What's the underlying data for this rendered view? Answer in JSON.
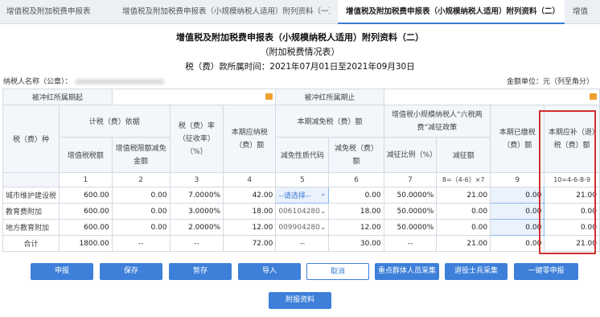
{
  "tabs": [
    "增值税及附加税费申报表",
    "增值税及附加税费申报表（小规模纳税人适用）附列资料（一）",
    "增值税及附加税费申报表（小规模纳税人适用）附列资料（二）",
    "增值"
  ],
  "form": {
    "title": "增值税及附加税费申报表（小规模纳税人适用）附列资料（二）",
    "subtitle": "（附加税费情况表）",
    "period": "税（费）款所属时间：2021年07月01日至2021年09月30日",
    "taxpayer_label": "纳税人名称（公章）：",
    "unit_label": "金额单位：元（列至角分）"
  },
  "table": {
    "offset_start_label": "被冲红所属期起",
    "offset_end_label": "被冲红所属期止",
    "col_tax_type": "税（费）种",
    "group_basis": "计税（费）依据",
    "col_vat_amount": "增值税税额",
    "col_vat_exempt": "增值税限额减免金额",
    "col_rate": "税（费）率（征收率）（%）",
    "col_payable": "本期应纳税（费）额",
    "group_relief": "本期减免税（费）额",
    "col_relief_code": "减免性质代码",
    "col_relief_amount": "减免税（费）额",
    "group_six_tax": "增值税小规模纳税人“六税两费”减征政策",
    "col_reduce_ratio": "减征比例（%）",
    "col_reduce_amount": "减征额",
    "col_paid": "本期已缴税（费）额",
    "col_refund": "本期应补（退）税（费）额",
    "col_numbers": [
      "1",
      "2",
      "3",
      "4",
      "5",
      "6",
      "7",
      "8=（4-6）×7",
      "9",
      "10=4-6-8-9"
    ],
    "rows": [
      {
        "name": "城市维护建设税",
        "vat": "600.00",
        "exempt": "0.00",
        "rate": "7.0000%",
        "payable": "42.00",
        "code": "--请选择--",
        "relief": "0.00",
        "ratio": "50.0000%",
        "reduce": "21.00",
        "paid": "0.00",
        "refund": "21.00"
      },
      {
        "name": "教育费附加",
        "vat": "600.00",
        "exempt": "0.00",
        "rate": "3.0000%",
        "payable": "18.00",
        "code": "006104280",
        "relief": "18.00",
        "ratio": "50.0000%",
        "reduce": "0.00",
        "paid": "0.00",
        "refund": "0.00"
      },
      {
        "name": "地方教育附加",
        "vat": "600.00",
        "exempt": "0.00",
        "rate": "2.0000%",
        "payable": "12.00",
        "code": "009904280",
        "relief": "12.00",
        "ratio": "50.0000%",
        "reduce": "0.00",
        "paid": "0.00",
        "refund": "0.00"
      }
    ],
    "total": {
      "name": "合计",
      "vat": "1800.00",
      "exempt": "--",
      "rate": "--",
      "payable": "72.00",
      "code": "--",
      "relief": "30.00",
      "ratio": "--",
      "reduce": "21.00",
      "paid": "0.00",
      "refund": "21.00"
    }
  },
  "buttons": [
    "申报",
    "保存",
    "暂存",
    "导入",
    "取消",
    "重点群体人员采集",
    "退役士兵采集",
    "一键零申报"
  ],
  "attachment_button": "附报资料",
  "colors": {
    "accent": "#3d7fd9",
    "highlight": "#d32f2f"
  }
}
